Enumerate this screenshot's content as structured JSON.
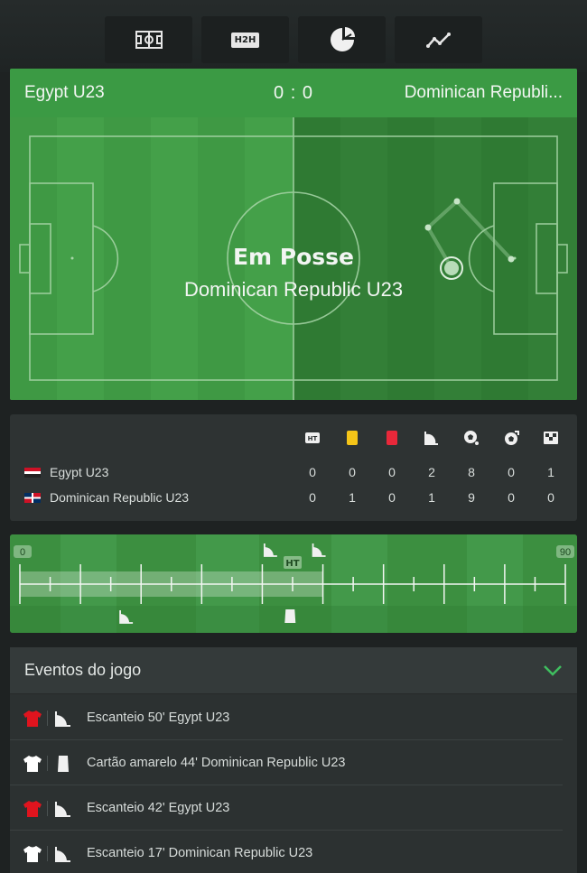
{
  "tabs": [
    {
      "name": "pitch",
      "label": ""
    },
    {
      "name": "h2h",
      "label": "H2H"
    },
    {
      "name": "stats",
      "label": ""
    },
    {
      "name": "trend",
      "label": ""
    }
  ],
  "match": {
    "home": "Egypt U23",
    "away": "Dominican Republi...",
    "score": "0 : 0",
    "possession_label": "Em Posse",
    "possession_team": "Dominican Republic U23"
  },
  "stats": {
    "icons": [
      "ht-icon",
      "yellow-card-icon",
      "red-card-icon",
      "corner-flag-icon",
      "ball-icon",
      "ball-goal-icon",
      "penalty-flag-icon"
    ],
    "rows": [
      {
        "team": "Egypt U23",
        "flag": "egypt",
        "values": [
          "0",
          "0",
          "0",
          "2",
          "8",
          "0",
          "1"
        ]
      },
      {
        "team": "Dominican Republic U23",
        "flag": "dominican-republic",
        "values": [
          "0",
          "1",
          "0",
          "1",
          "9",
          "0",
          "0"
        ]
      }
    ]
  },
  "timeline": {
    "start_label": "0",
    "end_label": "90",
    "ht_label": "HT",
    "progress_minute": 50,
    "events_top": [
      {
        "type": "corner",
        "minute": 42
      },
      {
        "type": "corner",
        "minute": 50
      }
    ],
    "events_bottom": [
      {
        "type": "corner",
        "minute": 17
      },
      {
        "type": "yellow-card",
        "minute": 44
      }
    ]
  },
  "events": {
    "title": "Eventos do jogo",
    "items": [
      {
        "team": "home",
        "shirt_color": "#e0141e",
        "icon": "corner-flag-icon",
        "text": "Escanteio 50' Egypt U23"
      },
      {
        "team": "away",
        "shirt_color": "#ffffff",
        "icon": "yellow-card-icon",
        "text": "Cartão amarelo 44' Dominican Republic U23"
      },
      {
        "team": "home",
        "shirt_color": "#e0141e",
        "icon": "corner-flag-icon",
        "text": "Escanteio 42' Egypt U23"
      },
      {
        "team": "away",
        "shirt_color": "#ffffff",
        "icon": "corner-flag-icon",
        "text": "Escanteio 17' Dominican Republic U23"
      }
    ]
  },
  "colors": {
    "accent_green": "#3fbf5f",
    "yellow": "#f5c518",
    "red": "#e8283a"
  }
}
